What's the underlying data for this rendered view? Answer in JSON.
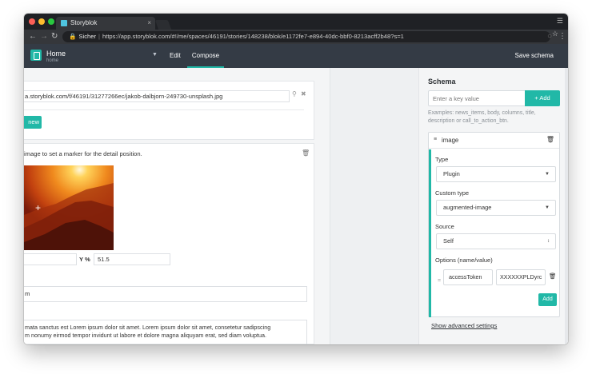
{
  "browser": {
    "tab_title": "Storyblok",
    "tab_close": "×",
    "url_secure_label": "Sicher",
    "url": "https://app.storyblok.com/#!/me/spaces/46191/stories/148238/blok/e1172fe7-e894-40dc-bbf0-8213acff2b48?s=1"
  },
  "header": {
    "title": "Home",
    "subtitle": "home",
    "tabs": [
      "Edit",
      "Compose"
    ],
    "active_tab": "Compose",
    "save_label": "Save schema"
  },
  "left": {
    "image_url": "a.storyblok.com/f/46191/31277266ec/jakob-dalbjorn-249730-unsplash.jpg",
    "new_button": "new",
    "hint": "image to set a marker for the detail position.",
    "y_label": "Y %",
    "y_value": "51.5",
    "field_value": "m",
    "body_text_1": "mata sanctus est Lorem ipsum dolor sit amet. Lorem ipsum dolor sit amet, consetetur sadipscing",
    "body_text_2": "m nonumy eirmod tempor invidunt ut labore et dolore magna aliquyam erat, sed diam voluptua."
  },
  "schema": {
    "title": "Schema",
    "key_placeholder": "Enter a key value",
    "add_button": "+ Add",
    "examples": "Examples: news_items, body, columns, title, description or call_to_action_btn.",
    "field": {
      "name": "image",
      "type_label": "Type",
      "type_value": "Plugin",
      "custom_type_label": "Custom type",
      "custom_type_value": "augmented-image",
      "source_label": "Source",
      "source_value": "Self",
      "options_label": "Options (name/value)",
      "option_name": "accessToken",
      "option_value": "XXXXXXPLDyrc",
      "add_option": "Add"
    },
    "advanced_link": "Show advanced settings"
  },
  "colors": {
    "accent": "#21b8a7",
    "header_bg": "#343b45"
  }
}
